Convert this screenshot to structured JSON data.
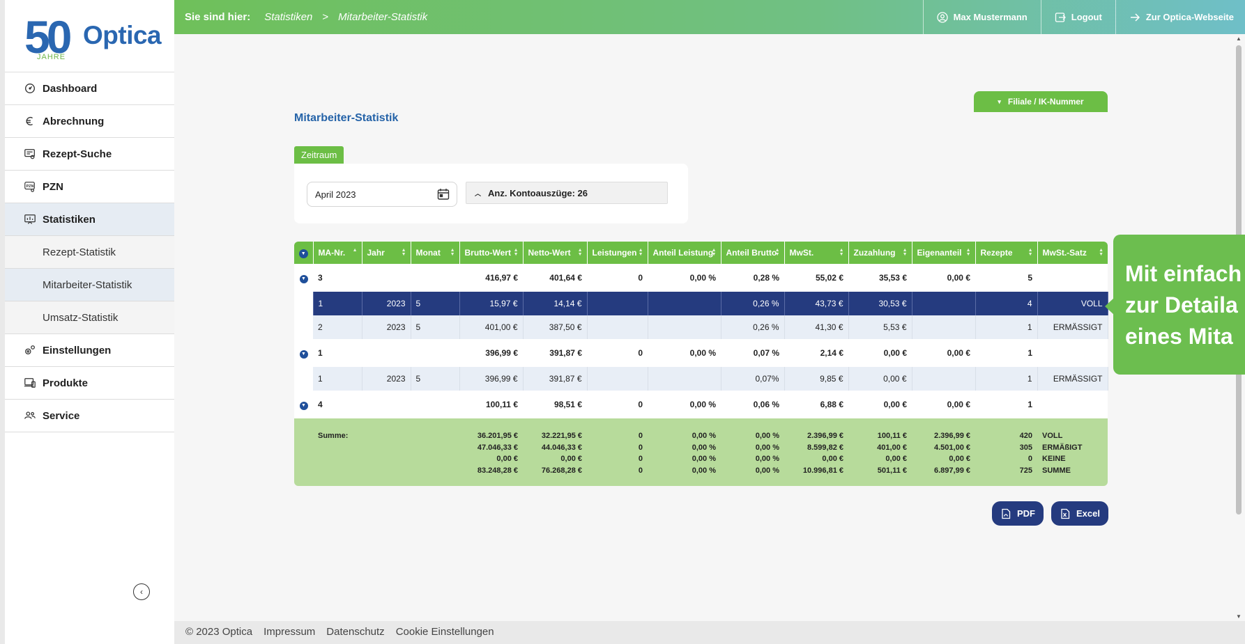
{
  "logo": {
    "anniversary": "50",
    "jahre": "JAHRE",
    "brand": "Optica"
  },
  "sidebar": {
    "items": [
      {
        "label": "Dashboard",
        "icon": "gauge-icon"
      },
      {
        "label": "Abrechnung",
        "icon": "euro-icon"
      },
      {
        "label": "Rezept-Suche",
        "icon": "prescription-search-icon"
      },
      {
        "label": "PZN",
        "icon": "pzn-icon"
      },
      {
        "label": "Statistiken",
        "icon": "statistics-icon",
        "active": true
      }
    ],
    "sub_items": [
      {
        "label": "Rezept-Statistik"
      },
      {
        "label": "Mitarbeiter-Statistik",
        "active": true
      },
      {
        "label": "Umsatz-Statistik"
      }
    ],
    "items_after": [
      {
        "label": "Einstellungen",
        "icon": "settings-icon"
      },
      {
        "label": "Produkte",
        "icon": "products-icon"
      },
      {
        "label": "Service",
        "icon": "service-icon"
      }
    ]
  },
  "topbar": {
    "breadcrumb_label": "Sie sind hier:",
    "breadcrumb": [
      "Statistiken",
      "Mitarbeiter-Statistik"
    ],
    "separator": ">",
    "user": "Max Mustermann",
    "logout": "Logout",
    "website": "Zur Optica-Webseite"
  },
  "main": {
    "filiale_button": "Filiale / IK-Nummer",
    "title": "Mitarbeiter-Statistik",
    "zeitraum_tab": "Zeitraum",
    "date_value": "April 2023",
    "konto_label": "Anz. Kontoauszüge: 26"
  },
  "table": {
    "headers": [
      "MA-Nr.",
      "Jahr",
      "Monat",
      "Brutto-Wert",
      "Netto-Wert",
      "Leistungen",
      "Anteil Leistung",
      "Anteil Brutto",
      "MwSt.",
      "Zuzahlung",
      "Eigenanteil",
      "Rezepte",
      "MwSt.-Satz"
    ],
    "rows": [
      {
        "type": "group",
        "cells": [
          "3",
          "",
          "",
          "416,97 €",
          "401,64 €",
          "0",
          "0,00 %",
          "0,28 %",
          "55,02 €",
          "35,53 €",
          "0,00 €",
          "5",
          ""
        ]
      },
      {
        "type": "detail",
        "selected": true,
        "cells": [
          "1",
          "2023",
          "5",
          "15,97 €",
          "14,14 €",
          "",
          "",
          "0,26 %",
          "43,73 €",
          "30,53 €",
          "",
          "4",
          "VOLL"
        ]
      },
      {
        "type": "detail",
        "cells": [
          "2",
          "2023",
          "5",
          "401,00 €",
          "387,50 €",
          "",
          "",
          "0,26 %",
          "41,30 €",
          "5,53 €",
          "",
          "1",
          "ERMÄSSIGT"
        ]
      },
      {
        "type": "group",
        "cells": [
          "1",
          "",
          "",
          "396,99 €",
          "391,87 €",
          "0",
          "0,00 %",
          "0,07 %",
          "2,14 €",
          "0,00 €",
          "0,00 €",
          "1",
          ""
        ]
      },
      {
        "type": "detail",
        "cells": [
          "1",
          "2023",
          "5",
          "396,99 €",
          "391,87 €",
          "",
          "",
          "0,07%",
          "9,85 €",
          "0,00 €",
          "",
          "1",
          "ERMÄSSIGT"
        ]
      },
      {
        "type": "group",
        "cells": [
          "4",
          "",
          "",
          "100,11 €",
          "98,51 €",
          "0",
          "0,00 %",
          "0,06 %",
          "6,88 €",
          "0,00 €",
          "0,00 €",
          "1",
          ""
        ]
      }
    ],
    "sum": {
      "label": "Summe:",
      "brutto": [
        "36.201,95 €",
        "47.046,33 €",
        "0,00 €",
        "83.248,28 €"
      ],
      "netto": [
        "32.221,95 €",
        "44.046,33 €",
        "0,00 €",
        "76.268,28 €"
      ],
      "leistungen": [
        "0",
        "0",
        "0",
        "0"
      ],
      "anteil_leistung": [
        "0,00 %",
        "0,00 %",
        "0,00 %",
        "0,00 %"
      ],
      "anteil_brutto": [
        "0,00 %",
        "0,00 %",
        "0,00 %",
        "0,00 %"
      ],
      "mwst": [
        "2.396,99 €",
        "8.599,82 €",
        "0,00 €",
        "10.996,81 €"
      ],
      "zuzahlung": [
        "100,11 €",
        "401,00 €",
        "0,00 €",
        "501,11 €"
      ],
      "eigenanteil": [
        "2.396,99 €",
        "4.501,00 €",
        "0,00 €",
        "6.897,99 €"
      ],
      "rezepte": [
        "420",
        "305",
        "0",
        "725"
      ],
      "satz": [
        "VOLL",
        "ERMÄßIGT",
        "KEINE",
        "SUMME"
      ]
    }
  },
  "export": {
    "pdf": "PDF",
    "excel": "Excel"
  },
  "callout": {
    "lines": [
      "Mit einfach",
      "zur Detaila",
      "eines Mita"
    ]
  },
  "footer": {
    "copyright": "© 2023 Optica",
    "links": [
      "Impressum",
      "Datenschutz",
      "Cookie Einstellungen"
    ]
  },
  "colors": {
    "green": "#6cbe45",
    "navy": "#253b7f",
    "blue_title": "#2563a8",
    "sum_bg": "#b7db9b"
  }
}
